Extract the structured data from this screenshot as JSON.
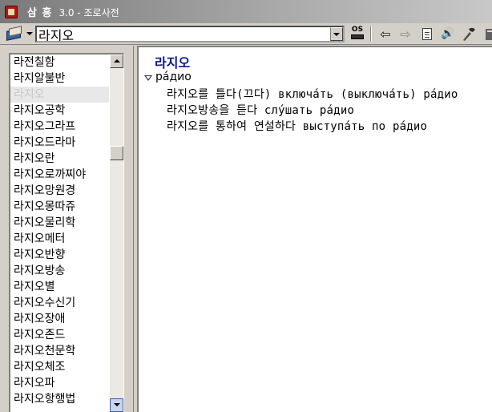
{
  "window": {
    "title": "삼 흥",
    "version_text": "3.0 - 조로사전"
  },
  "toolbar": {
    "search_value": "라지오",
    "os_label": "OS",
    "back_glyph": "⇦",
    "forward_glyph": "⇨",
    "sound_glyph": "🔊"
  },
  "word_list": {
    "items": [
      "라전칠함",
      "라지알불반",
      "라지오",
      "라지오공학",
      "라지오그라프",
      "라지오드라마",
      "라지오란",
      "라지오로까찌야",
      "라지오망원경",
      "라지오몽따쥬",
      "라지오물리학",
      "라지오메터",
      "라지오반향",
      "라지오방송",
      "라지오별",
      "라지오수신기",
      "라지오장애",
      "라지오존드",
      "라지오천문학",
      "라지오체조",
      "라지오파",
      "라지오항행법"
    ],
    "selected_index": 2
  },
  "entry": {
    "headword": "라지오",
    "translation": "ра́дио",
    "examples": [
      "라지오를 틀다(끄다) включа́ть (выключа́ть) ра́дио",
      "라지오방송을 듣다 слу́шать ра́дио",
      "라지오를 통하여 연설하다 выступа́ть по ра́дио"
    ]
  }
}
